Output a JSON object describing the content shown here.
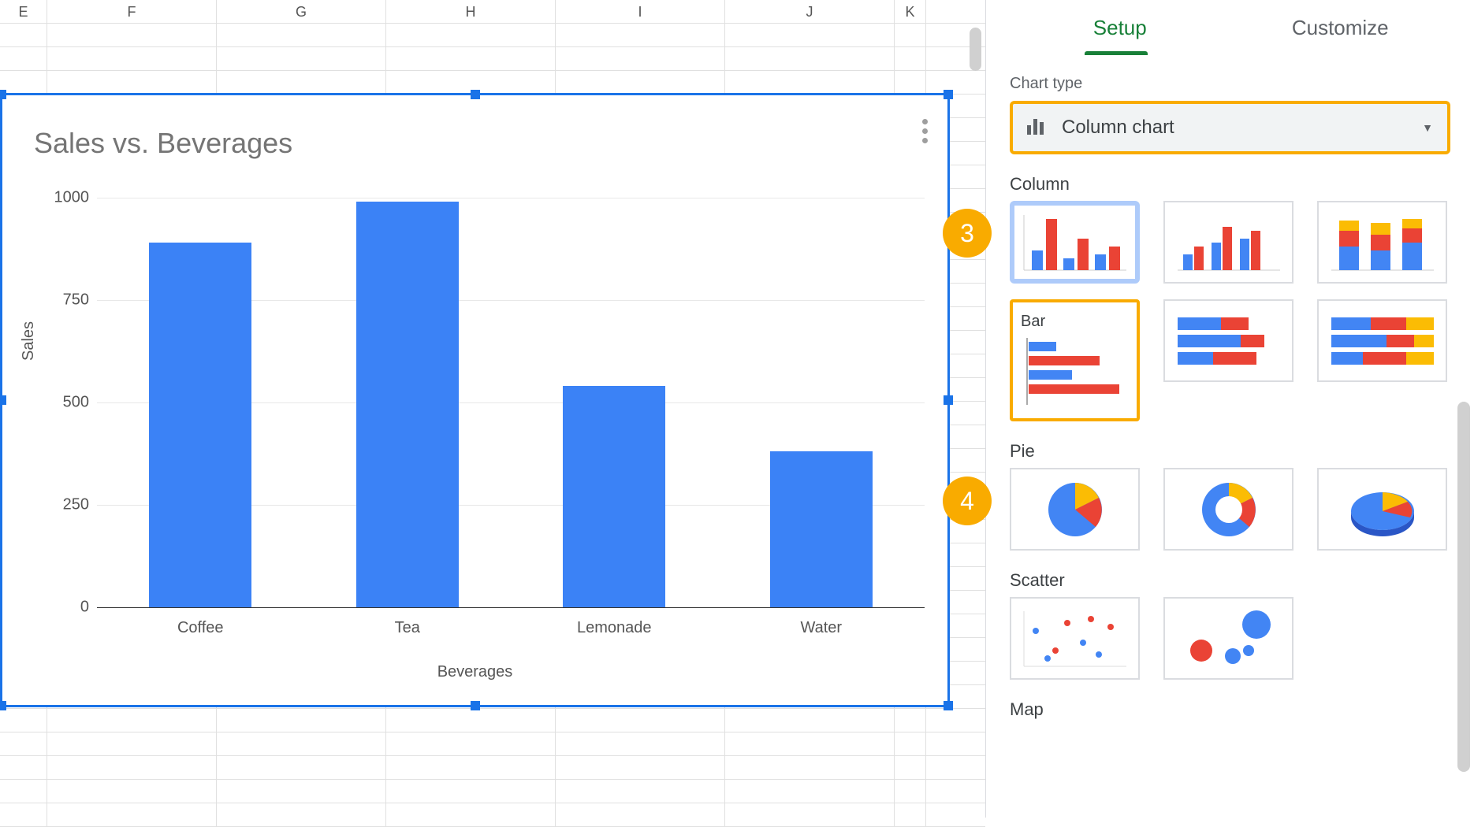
{
  "columns": [
    "E",
    "F",
    "G",
    "H",
    "I",
    "J",
    "K"
  ],
  "sidebar": {
    "tabs": {
      "setup": "Setup",
      "customize": "Customize"
    },
    "chart_type_label": "Chart type",
    "chart_type_value": "Column chart",
    "categories": {
      "column": "Column",
      "bar": "Bar",
      "pie": "Pie",
      "scatter": "Scatter",
      "map": "Map"
    }
  },
  "annotations": {
    "step3": "3",
    "step4": "4"
  },
  "chart_data": {
    "type": "bar",
    "title": "Sales vs. Beverages",
    "xlabel": "Beverages",
    "ylabel": "Sales",
    "categories": [
      "Coffee",
      "Tea",
      "Lemonade",
      "Water"
    ],
    "values": [
      890,
      990,
      540,
      380
    ],
    "yticks": [
      0,
      250,
      500,
      750,
      1000
    ],
    "ylim": [
      0,
      1000
    ]
  }
}
